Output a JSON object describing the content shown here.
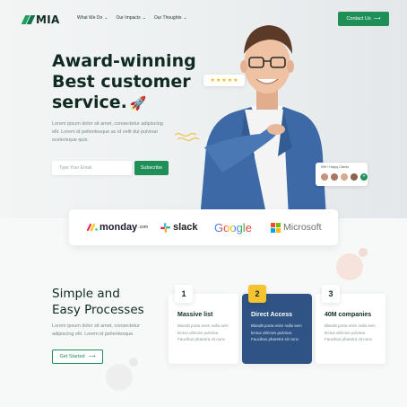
{
  "brand": {
    "name": "MIA"
  },
  "nav": {
    "items": [
      {
        "label": "What We Do"
      },
      {
        "label": "Our Impacts"
      },
      {
        "label": "Our Thoughts"
      }
    ],
    "contact_label": "Contact Us"
  },
  "hero": {
    "title_line1": "Award-winning",
    "title_line2": "Best customer",
    "title_line3": "service.",
    "description": "Lorem ipsum dolor sit amet, consectetur adipiscing elit. Lorem id pellentesque ac id velit dui pulvinar scelerisque quis.",
    "email_placeholder": "Type Your Email",
    "subscribe_label": "Subscribe",
    "rating_stars": 5,
    "happy_clients_label": "50K+ Happy Clients",
    "happy_clients_more": "+"
  },
  "brands": {
    "monday": "monday",
    "monday_suffix": ".com",
    "slack": "slack",
    "google": "Google",
    "microsoft": "Microsoft"
  },
  "processes": {
    "title_line1": "Simple and",
    "title_line2": "Easy Processes",
    "description": "Lorem ipsum dolor sit amet, consectetur adipiscing elit. Lorem id pellentesque.",
    "cta_label": "Get Started",
    "cards": [
      {
        "number": "1",
        "title": "Massive list",
        "text": "Blandit porta enim nulla sem lectus ultricies pulvinar. Faucibus pharetra sit nunc."
      },
      {
        "number": "2",
        "title": "Direct Access",
        "text": "Blandit porta enim nulla sem lectus ultricies pulvinar. Faucibus pharetra sit nunc."
      },
      {
        "number": "3",
        "title": "40M companies",
        "text": "Blandit porta enim nulla sem lectus ultricies pulvinar. Faucibus pharetra sit nunc."
      }
    ]
  },
  "colors": {
    "primary_green": "#1f8e57",
    "dark_text": "#0f2b20",
    "navy_card": "#2f5384",
    "yellow_badge": "#f5c330",
    "star": "#f2b600"
  }
}
